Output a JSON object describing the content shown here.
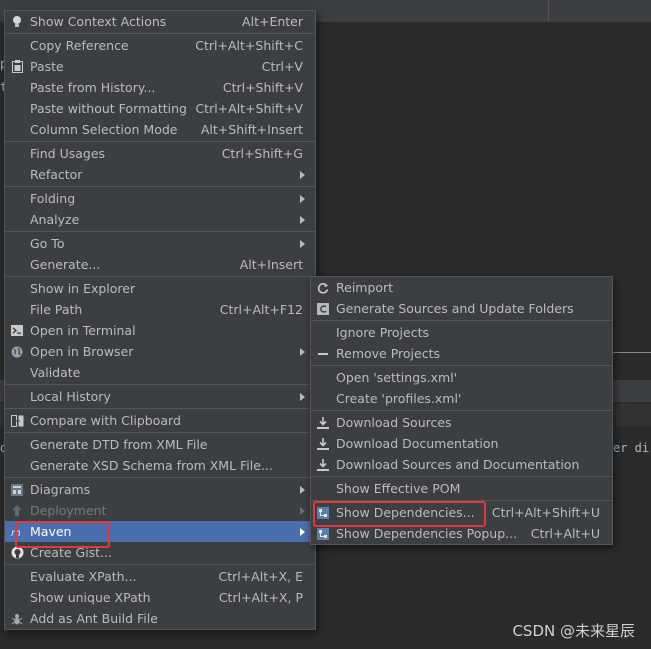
{
  "background": {
    "editor_fragments": [
      "p",
      "t",
      "o",
      "er di"
    ]
  },
  "watermark": "CSDN @未来星辰",
  "main_menu": {
    "items": [
      {
        "label": "Show Context Actions",
        "shortcut": "Alt+Enter",
        "icon": "lightbulb-icon"
      },
      {
        "label": "Copy Reference",
        "shortcut": "Ctrl+Alt+Shift+C"
      },
      {
        "label": "Paste",
        "shortcut": "Ctrl+V",
        "icon": "clipboard-icon"
      },
      {
        "label": "Paste from History...",
        "shortcut": "Ctrl+Shift+V"
      },
      {
        "label": "Paste without Formatting",
        "shortcut": "Ctrl+Alt+Shift+V"
      },
      {
        "label": "Column Selection Mode",
        "shortcut": "Alt+Shift+Insert"
      },
      {
        "label": "Find Usages",
        "shortcut": "Ctrl+Shift+G"
      },
      {
        "label": "Refactor"
      },
      {
        "label": "Folding"
      },
      {
        "label": "Analyze"
      },
      {
        "label": "Go To"
      },
      {
        "label": "Generate...",
        "shortcut": "Alt+Insert"
      },
      {
        "label": "Show in Explorer"
      },
      {
        "label": "File Path",
        "shortcut": "Ctrl+Alt+F12"
      },
      {
        "label": "Open in Terminal",
        "icon": "terminal-icon"
      },
      {
        "label": "Open in Browser",
        "icon": "globe-icon"
      },
      {
        "label": "Validate"
      },
      {
        "label": "Local History"
      },
      {
        "label": "Compare with Clipboard",
        "icon": "compare-icon"
      },
      {
        "label": "Generate DTD from XML File"
      },
      {
        "label": "Generate XSD Schema from XML File..."
      },
      {
        "label": "Diagrams",
        "icon": "diagram-icon"
      },
      {
        "label": "Deployment",
        "icon": "deployment-icon"
      },
      {
        "label": "Maven",
        "icon": "maven-icon"
      },
      {
        "label": "Create Gist...",
        "icon": "github-icon"
      },
      {
        "label": "Evaluate XPath...",
        "shortcut": "Ctrl+Alt+X, E"
      },
      {
        "label": "Show unique XPath",
        "shortcut": "Ctrl+Alt+X, P"
      },
      {
        "label": "Add as Ant Build File",
        "icon": "ant-icon"
      }
    ]
  },
  "maven_submenu": {
    "items": [
      {
        "label": "Reimport",
        "icon": "reimport-icon"
      },
      {
        "label": "Generate Sources and Update Folders",
        "icon": "generate-sources-icon"
      },
      {
        "label": "Ignore Projects"
      },
      {
        "label": "Remove Projects",
        "icon": "minus-icon"
      },
      {
        "label": "Open 'settings.xml'"
      },
      {
        "label": "Create 'profiles.xml'"
      },
      {
        "label": "Download Sources",
        "icon": "download-icon"
      },
      {
        "label": "Download Documentation",
        "icon": "download-icon"
      },
      {
        "label": "Download Sources and Documentation",
        "icon": "download-icon"
      },
      {
        "label": "Show Effective POM"
      },
      {
        "label": "Show Dependencies...",
        "shortcut": "Ctrl+Alt+Shift+U",
        "icon": "dependencies-icon"
      },
      {
        "label": "Show Dependencies Popup...",
        "shortcut": "Ctrl+Alt+U",
        "icon": "dependencies-icon"
      }
    ]
  },
  "colors": {
    "menu_bg": "#3c3f41",
    "selection": "#4b6eaf",
    "highlight_box": "#e0393a"
  }
}
